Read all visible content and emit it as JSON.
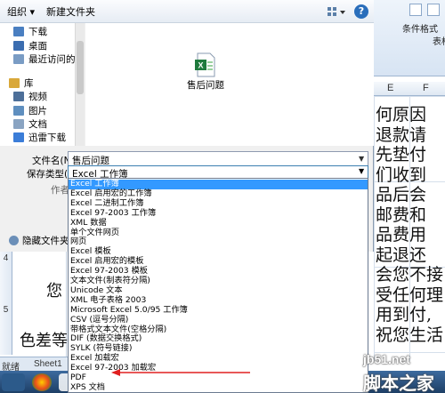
{
  "toolbar": {
    "organize": "组织 ▾",
    "new_folder": "新建文件夹"
  },
  "nav": {
    "items": [
      {
        "label": "下载",
        "color": "#4a7fc1"
      },
      {
        "label": "桌面",
        "color": "#3b6db0"
      },
      {
        "label": "最近访问的位置",
        "color": "#7a9cc4"
      },
      {
        "label": "库",
        "color": "#d9a83a"
      },
      {
        "label": "视频",
        "color": "#4d6f99"
      },
      {
        "label": "图片",
        "color": "#5f8fbf"
      },
      {
        "label": "文档",
        "color": "#8aa4c2"
      },
      {
        "label": "迅雷下载",
        "color": "#3b7dd8"
      }
    ]
  },
  "file": {
    "name": "售后问题"
  },
  "form": {
    "filename_label": "文件名(N):",
    "filename_value": "售后问题",
    "savetype_label": "保存类型(T):",
    "savetype_value": "Excel 工作簿",
    "author_label": "作者"
  },
  "hide_folders": "隐藏文件夹",
  "save_types": [
    "Excel 工作簿",
    "Excel 启用宏的工作簿",
    "Excel 二进制工作簿",
    "Excel 97-2003 工作簿",
    "XML 数据",
    "单个文件网页",
    "网页",
    "Excel 模板",
    "Excel 启用宏的模板",
    "Excel 97-2003 模板",
    "文本文件(制表符分隔)",
    "Unicode 文本",
    "XML 电子表格 2003",
    "Microsoft Excel 5.0/95 工作簿",
    "CSV (逗号分隔)",
    "带格式文本文件(空格分隔)",
    "DIF (数据交换格式)",
    "SYLK (符号链接)",
    "Excel 加载宏",
    "Excel 97-2003 加载宏",
    "PDF",
    "XPS 文档"
  ],
  "selected_index": 0,
  "excel": {
    "ribbon": {
      "format_label": "条件格式",
      "table_label": "表格",
      "col_e": "E",
      "col_f": "F"
    },
    "text_lines": [
      "何原因",
      "退款请",
      "先垫付",
      "们收到",
      "品后会",
      "邮费和",
      "品费用",
      "起退还",
      "会您不接",
      "受任何理",
      "用到付,",
      "祝您生活"
    ],
    "row4": "4",
    "row5": "5",
    "cell_text1": "您",
    "cell_text2": "色差等",
    "sheet_tab": "Sheet1",
    "status": "就绪"
  },
  "watermark": {
    "site": "jb51.net",
    "name": "脚本之家"
  },
  "colors": {
    "selection": "#3399ff",
    "arrow": "#e02020"
  }
}
